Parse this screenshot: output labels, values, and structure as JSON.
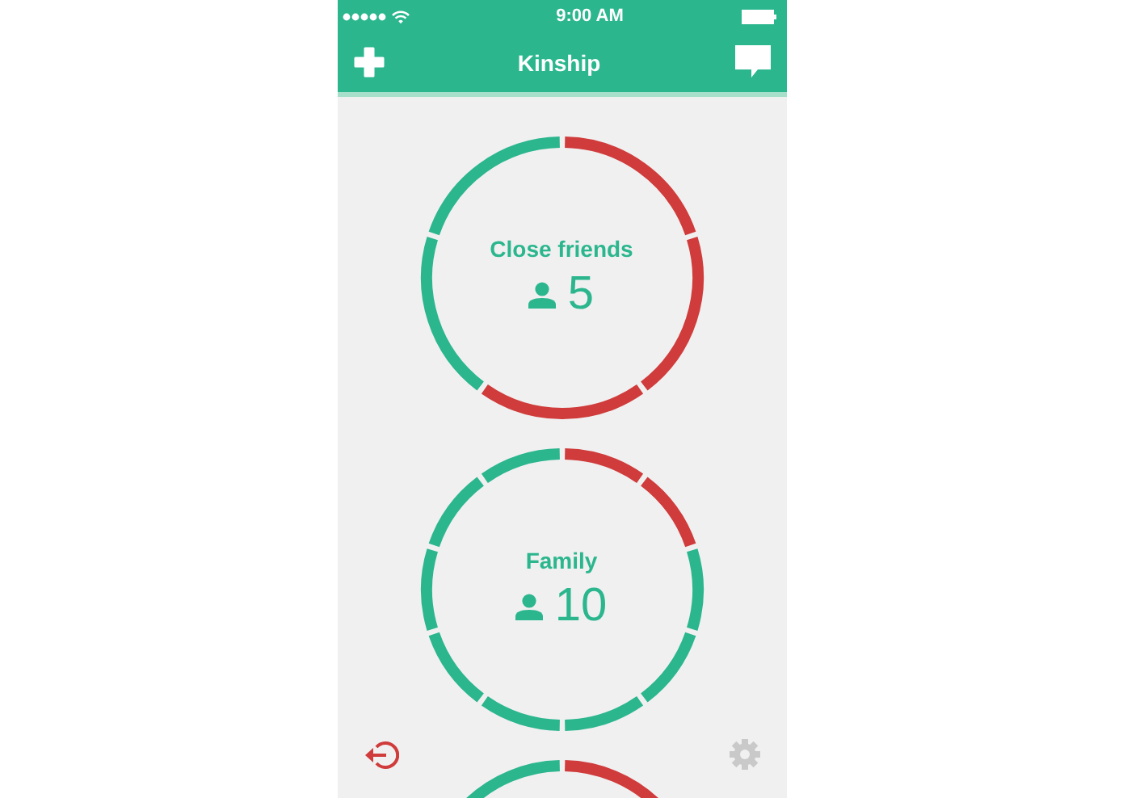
{
  "status_bar": {
    "time": "9:00 AM"
  },
  "nav_bar": {
    "title": "Kinship"
  },
  "circles": [
    {
      "name": "Close friends",
      "count": "5",
      "segments": [
        {
          "color": "#d03b3b"
        },
        {
          "color": "#d03b3b"
        },
        {
          "color": "#d03b3b"
        },
        {
          "color": "#2bb68e"
        },
        {
          "color": "#2bb68e"
        }
      ]
    },
    {
      "name": "Family",
      "count": "10",
      "segments": [
        {
          "color": "#d03b3b"
        },
        {
          "color": "#d03b3b"
        },
        {
          "color": "#2bb68e"
        },
        {
          "color": "#2bb68e"
        },
        {
          "color": "#2bb68e"
        },
        {
          "color": "#2bb68e"
        },
        {
          "color": "#2bb68e"
        },
        {
          "color": "#2bb68e"
        },
        {
          "color": "#2bb68e"
        },
        {
          "color": "#2bb68e"
        }
      ]
    },
    {
      "segments": [
        {
          "color": "#d03b3b"
        },
        {
          "color": "#2bb68e"
        }
      ]
    }
  ]
}
